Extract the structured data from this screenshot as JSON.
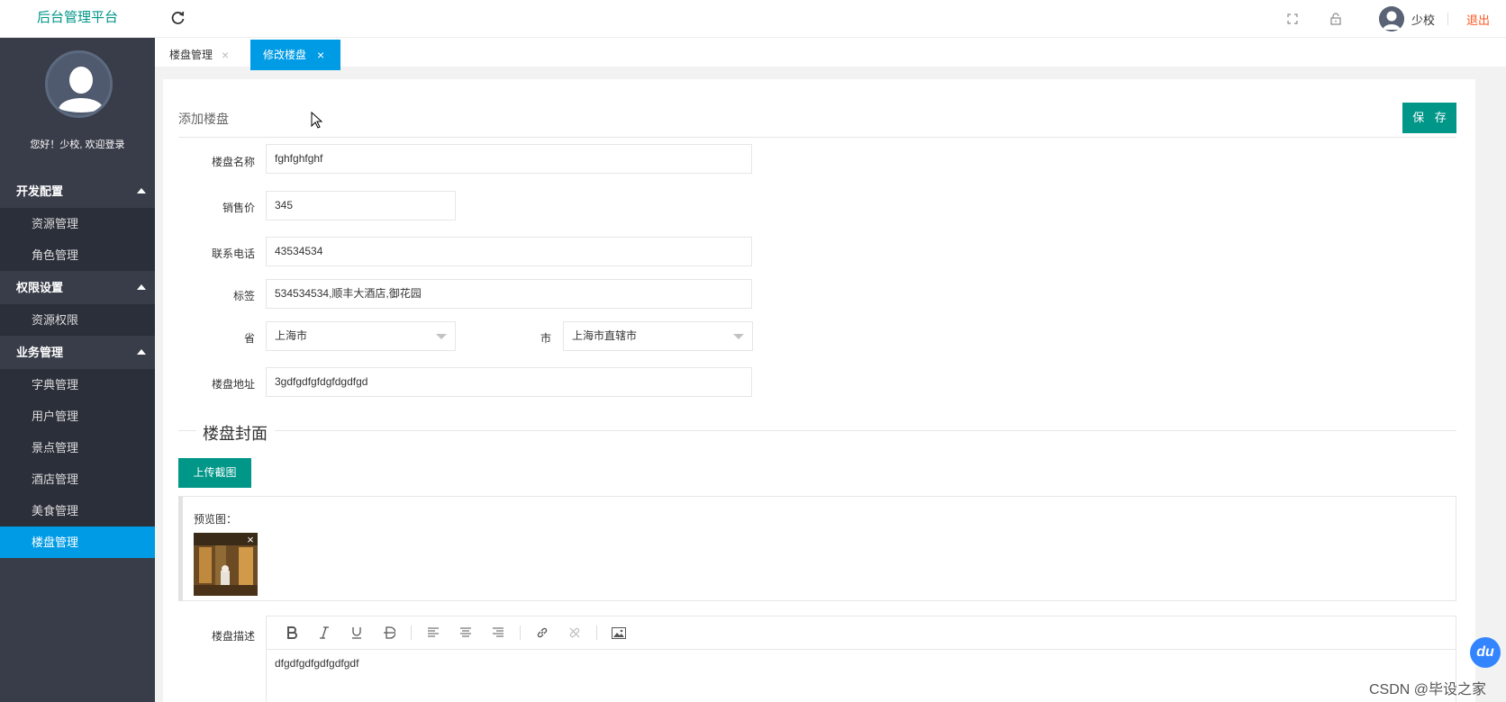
{
  "header": {
    "logo": "后台管理平台",
    "user_name": "少校",
    "logout": "退出"
  },
  "sidebar": {
    "welcome": "您好！少校, 欢迎登录",
    "groups": [
      {
        "label": "开发配置",
        "items": [
          "资源管理",
          "角色管理"
        ]
      },
      {
        "label": "权限设置",
        "items": [
          "资源权限"
        ]
      },
      {
        "label": "业务管理",
        "items": [
          "字典管理",
          "用户管理",
          "景点管理",
          "酒店管理",
          "美食管理",
          "楼盘管理"
        ]
      }
    ],
    "active_item": "楼盘管理"
  },
  "tabs": [
    {
      "label": "楼盘管理",
      "close": "×"
    },
    {
      "label": "修改楼盘",
      "close": "×"
    }
  ],
  "form": {
    "title": "添加楼盘",
    "save_label": "保 存",
    "fields": {
      "name": {
        "label": "楼盘名称",
        "value": "fghfghfghf"
      },
      "price": {
        "label": "销售价",
        "value": "345"
      },
      "phone": {
        "label": "联系电话",
        "value": "43534534"
      },
      "tags": {
        "label": "标签",
        "value": "534534534,顺丰大酒店,御花园"
      },
      "province": {
        "label": "省",
        "value": "上海市"
      },
      "city": {
        "label": "市",
        "value": "上海市直辖市"
      },
      "address": {
        "label": "楼盘地址",
        "value": "3gdfgdfgfdgfdgdfgd"
      }
    },
    "cover": {
      "section_title": "楼盘封面",
      "upload_label": "上传截图",
      "preview_label": "预览图：",
      "remove": "×"
    },
    "description": {
      "label": "楼盘描述",
      "content": "dfgdfgdfgdfgdfgdf",
      "toolbar": [
        "bold-icon",
        "italic-icon",
        "underline-icon",
        "strikethrough-icon",
        "align-left-icon",
        "align-center-icon",
        "align-right-icon",
        "link-icon",
        "unlink-icon",
        "image-icon"
      ]
    }
  },
  "overlay": {
    "badge": "du",
    "watermark": "CSDN @毕设之家"
  },
  "colors": {
    "primary": "#009688",
    "active_tab": "#009be5",
    "sidebar_bg": "#393d49",
    "logout": "#ff5722"
  }
}
